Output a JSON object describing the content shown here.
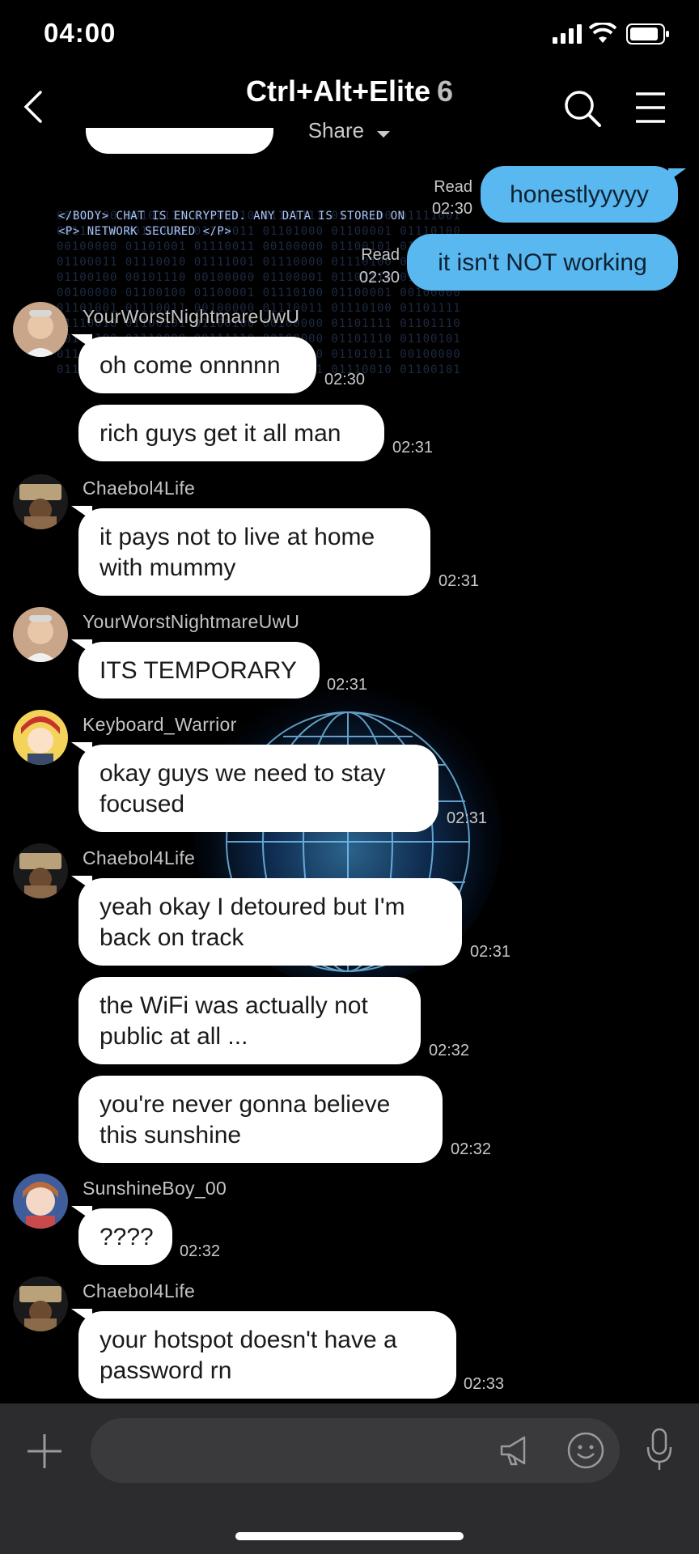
{
  "status_bar": {
    "time": "04:00"
  },
  "header": {
    "title": "Ctrl+Alt+Elite",
    "member_count": "6",
    "share_label": "Share"
  },
  "background": {
    "encrypted_line1": "</BODY> CHAT IS ENCRYPTED. ANY DATA IS STORED ON",
    "encrypted_line2": "<P> NETWORK SECURED </P>",
    "binary": "00111100 00101111 01100010 01101111 01100100 01111001\n00111110 00100000 01100011 01101000 01100001 01110100\n00100000 01101001 01110011 00100000 01100101 01101110\n01100011 01110010 01111001 01110000 01110100 01100101\n01100100 00101110 00100000 01100001 01101110 01111001\n00100000 01100100 01100001 01110100 01100001 00100000\n01101001 01110011 00100000 01110011 01110100 01101111\n01110010 01100101 01100100 00100000 01101111 01101110\n00111100 01110000 00111110 00100000 01101110 01100101\n01110100 01110111 01101111 01110010 01101011 00100000\n01110011 01100101 01100011 01110101 01110010 01100101"
  },
  "messages": {
    "out1": {
      "text": "honestlyyyyy",
      "status": "Read",
      "time": "02:30"
    },
    "out2": {
      "text": "it isn't NOT working",
      "status": "Read",
      "time": "02:30"
    },
    "m1": {
      "sender": "YourWorstNightmareUwU",
      "text": "oh come onnnnn",
      "time": "02:30"
    },
    "m2": {
      "text": "rich guys get it all man",
      "time": "02:31"
    },
    "m3": {
      "sender": "Chaebol4Life",
      "text": "it pays not to live at home\nwith mummy",
      "time": "02:31"
    },
    "m4": {
      "sender": "YourWorstNightmareUwU",
      "text": "ITS TEMPORARY",
      "time": "02:31"
    },
    "m5": {
      "sender": "Keyboard_Warrior",
      "text": "okay guys we need to stay\nfocused",
      "time": "02:31"
    },
    "m6": {
      "sender": "Chaebol4Life",
      "text": "yeah okay I detoured but I'm\nback on track",
      "time": "02:31"
    },
    "m7": {
      "text": "the WiFi was actually not\npublic at all ...",
      "time": "02:32"
    },
    "m8": {
      "text": "you're never gonna believe\nthis sunshine",
      "time": "02:32"
    },
    "m9": {
      "sender": "SunshineBoy_00",
      "text": "????",
      "time": "02:32"
    },
    "m10": {
      "sender": "Chaebol4Life",
      "text": "your hotspot doesn't have a\npassword rn",
      "time": "02:33"
    }
  },
  "icons": {
    "back": "chevron-left-icon",
    "search": "search-icon",
    "menu": "hamburger-menu-icon",
    "add": "plus-icon",
    "announce": "megaphone-icon",
    "emoji": "emoji-icon",
    "voice": "microphone-icon"
  },
  "colors": {
    "outgoing_bubble": "#5ab8f0",
    "incoming_bubble": "#ffffff",
    "background": "#000000",
    "input_bar": "#2c2c2e"
  }
}
